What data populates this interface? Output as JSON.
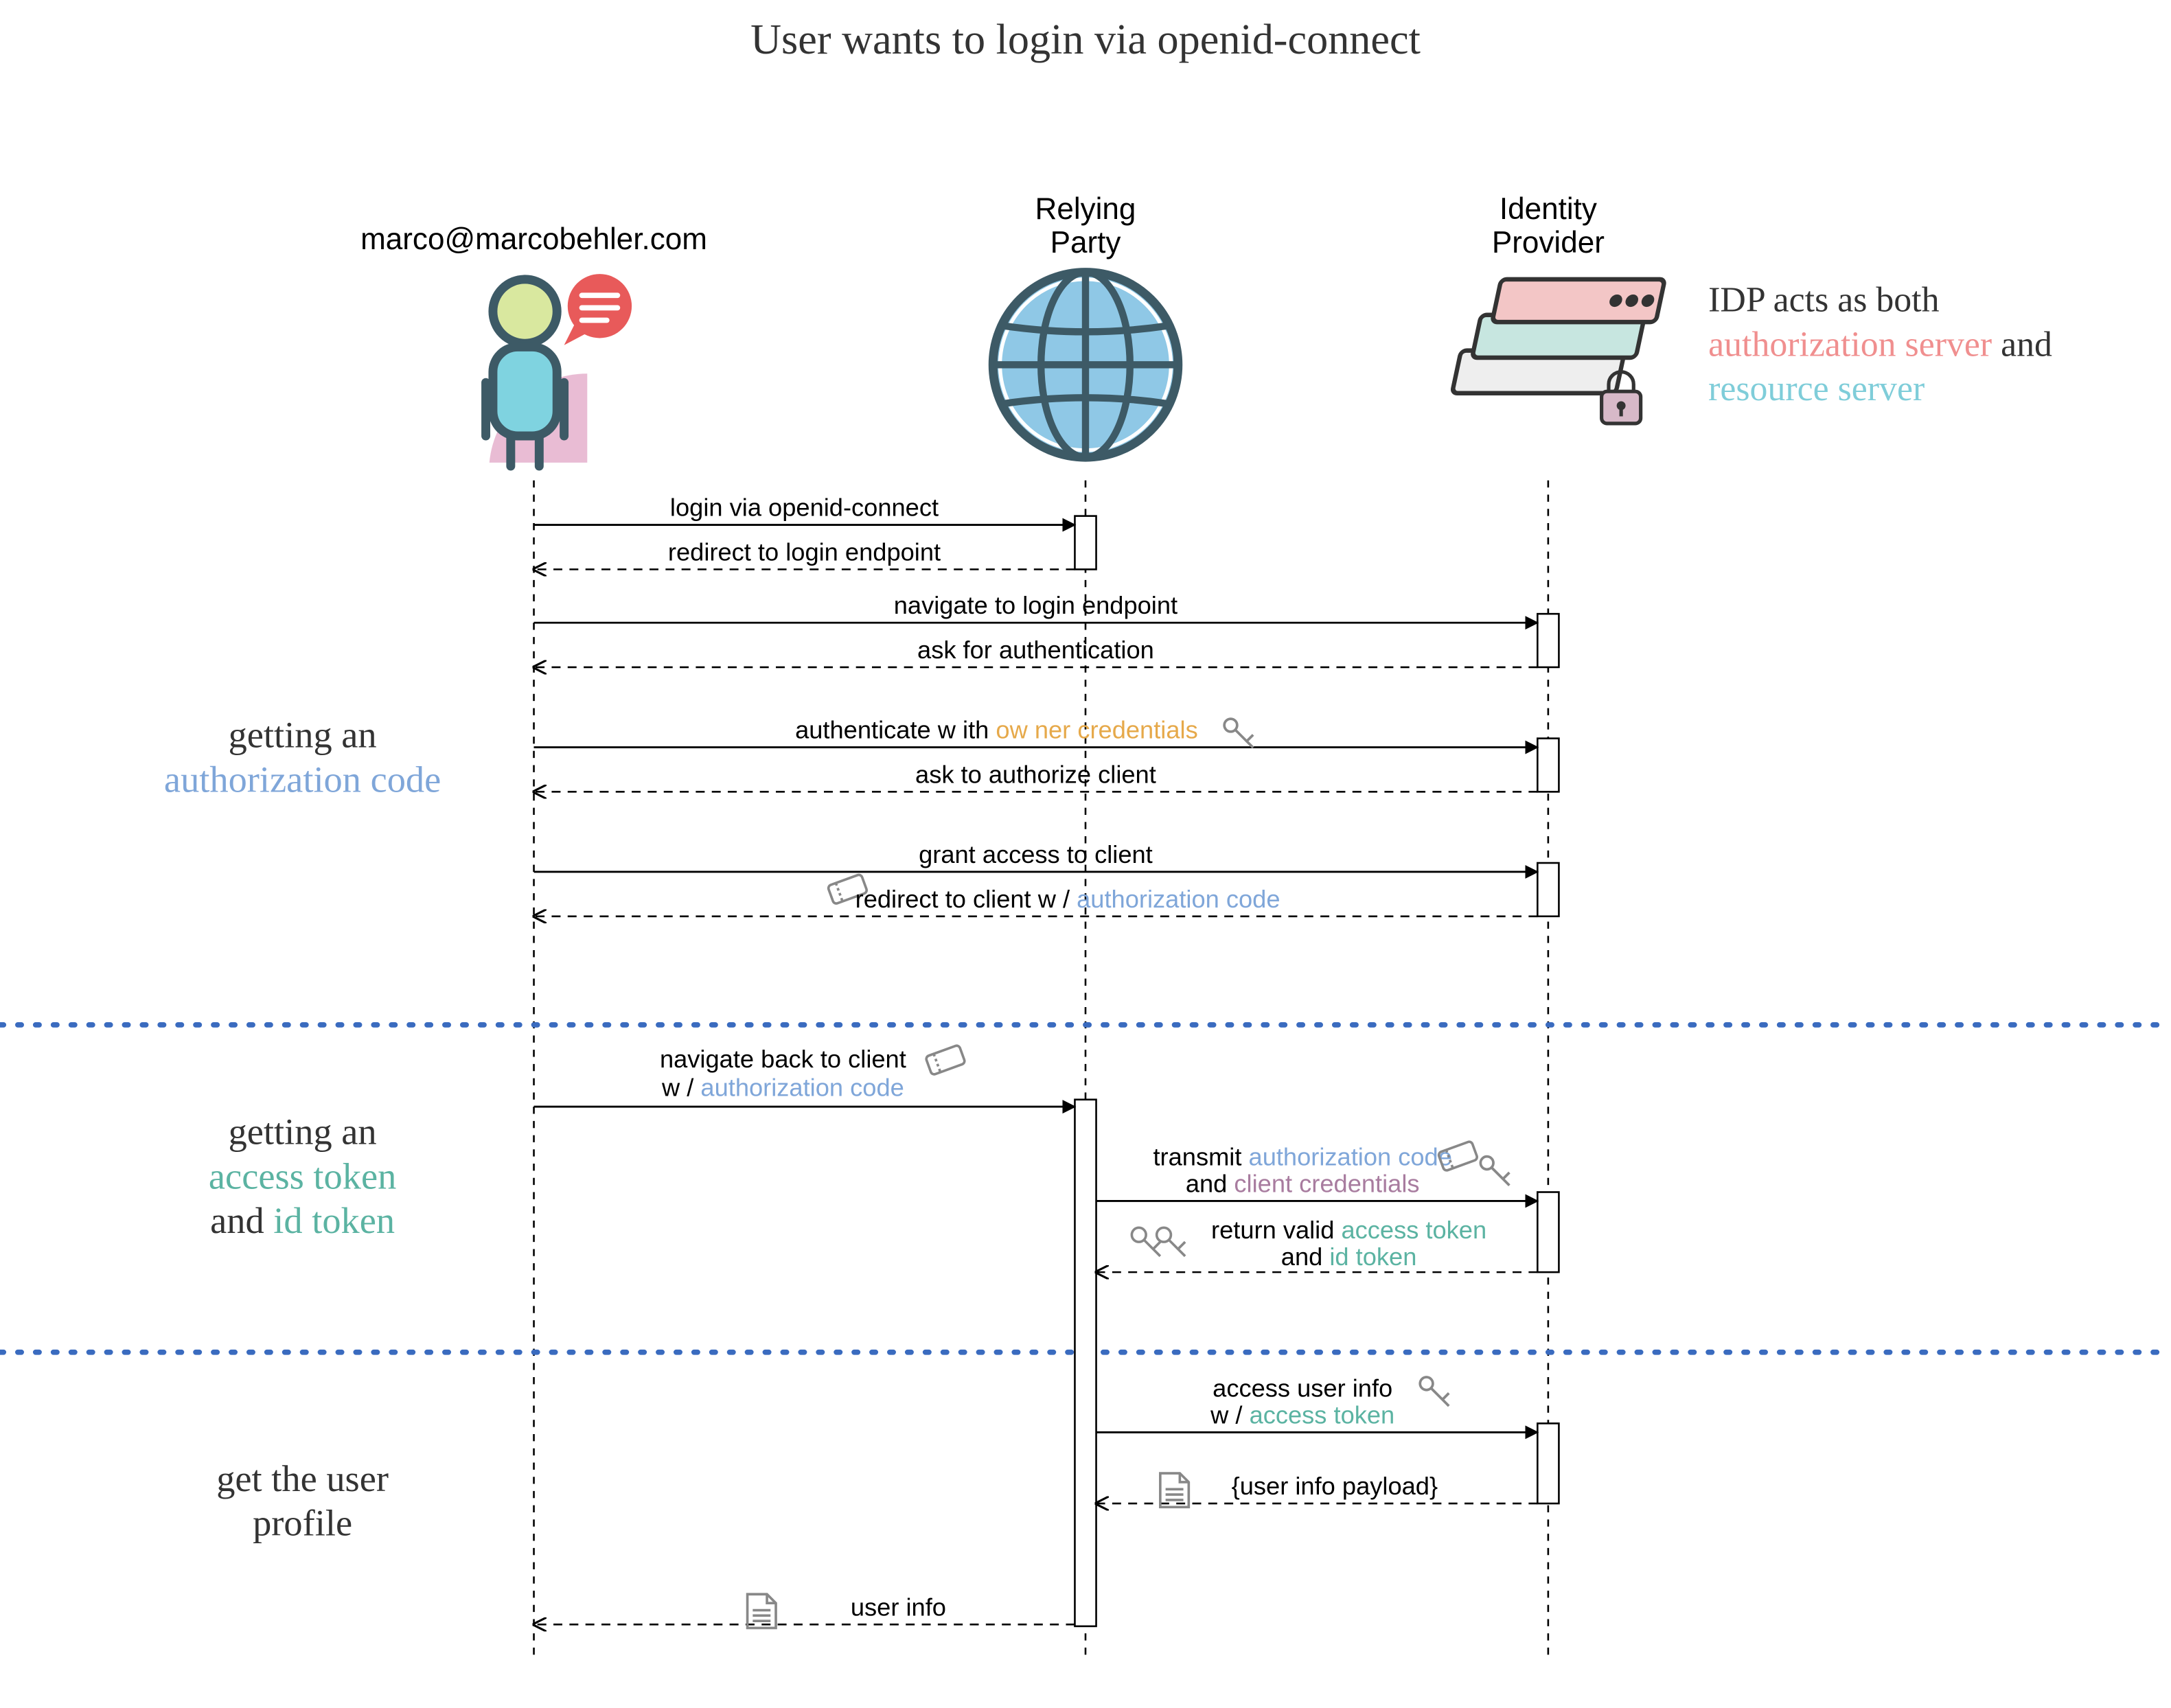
{
  "title": "User wants to login via openid-connect",
  "participants": {
    "user": {
      "label": "marco@marcobehler.com"
    },
    "rp": {
      "label_line1": "Relying",
      "label_line2": "Party"
    },
    "idp": {
      "label_line1": "Identity",
      "label_line2": "Provider"
    }
  },
  "idp_callout": {
    "line1": "IDP acts as both",
    "authz": "authorization server",
    "and": " and",
    "res": "resource server"
  },
  "sections": {
    "authz_code": {
      "line1": "getting an",
      "highlight": "authorization code"
    },
    "tokens": {
      "line1": "getting an",
      "access": "access token",
      "and": "and ",
      "id": "id token"
    },
    "profile": {
      "line1": "get the user",
      "line2": "profile"
    }
  },
  "messages": {
    "m1": "login via openid-connect",
    "m2": "redirect to login endpoint",
    "m3": "navigate to login endpoint",
    "m4": "ask for authentication",
    "m5a": "authenticate w ith ",
    "m5b": "ow ner credentials",
    "m6": "ask to authorize client",
    "m7": "grant access to client",
    "m8a": "redirect to client w / ",
    "m8b": "authorization code",
    "m9a": "navigate back to client",
    "m9b": "w / ",
    "m9c": "authorization code",
    "m10a": "transmit ",
    "m10b": "authorization code",
    "m10c": "and ",
    "m10d": "client credentials",
    "m11a": "return valid ",
    "m11b": "access token",
    "m11c": "and ",
    "m11d": "id token",
    "m12a": "access user info",
    "m12b": "w / ",
    "m12c": "access token",
    "m13": "{user info payload}",
    "m14": "user info"
  },
  "colors": {
    "teal": "#5bb3a2",
    "blue": "#7fa6d9",
    "orange": "#e6a94a",
    "plum": "#a87c9f",
    "pink": "#f08f8f"
  }
}
